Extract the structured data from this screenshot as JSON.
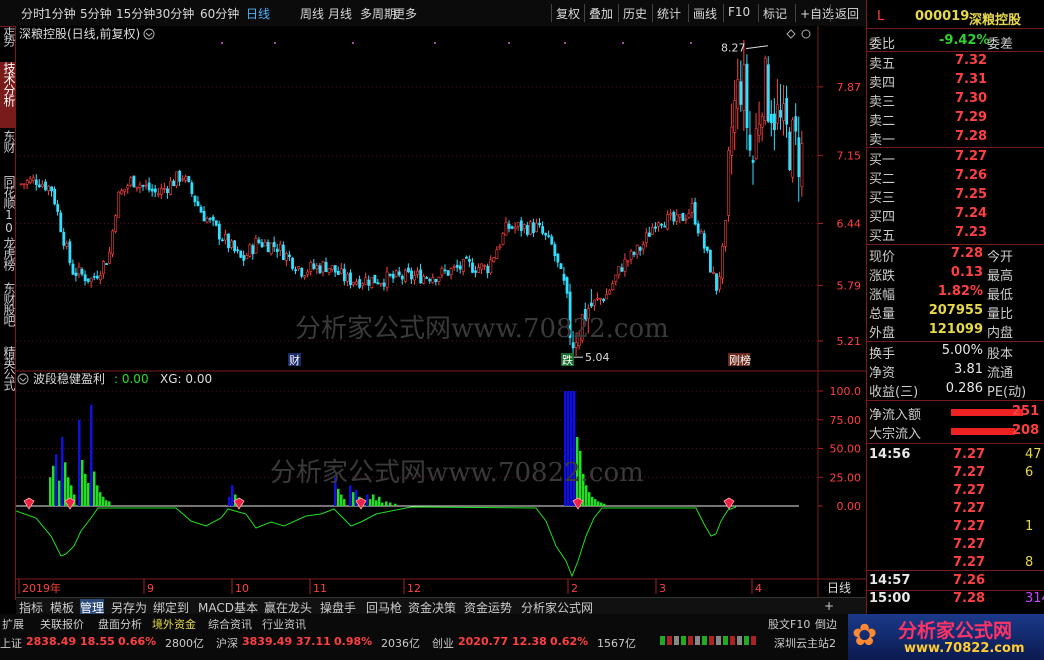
{
  "toolbar": {
    "period_tabs": [
      "分时",
      "1分钟",
      "5分钟",
      "15分钟",
      "30分钟",
      "60分钟",
      "日线",
      "周线",
      "月线",
      "多周期",
      "更多"
    ],
    "active_period": "日线",
    "right_tools": [
      "复权",
      "叠加",
      "历史",
      "统计",
      "画线",
      "F10",
      "标记",
      "+自选",
      "返回"
    ]
  },
  "left_tabs": [
    "分时走势",
    "技术分析",
    "东财10",
    "同花顺10",
    "龙虎榜",
    "东财股吧",
    "精英公式"
  ],
  "active_left_tab": "技术分析",
  "main_chart": {
    "title": "深粮控股(日线,前复权)",
    "high_label": "8.27",
    "low_label": "5.04",
    "y_ticks": [
      "7.87",
      "7.15",
      "6.44",
      "5.79",
      "5.21"
    ],
    "markers": [
      "财",
      "跌",
      "刚榜"
    ]
  },
  "indicator": {
    "name": "波段稳健盈利",
    "value_label": ": 0.00",
    "xg_label": "XG: 0.00",
    "y_ticks": [
      "100.0",
      "75.00",
      "50.00",
      "25.00",
      "0.00"
    ]
  },
  "date_axis": [
    "2019年",
    "9",
    "10",
    "11",
    "12",
    "2",
    "3",
    "4"
  ],
  "period_label": "日线",
  "bottom_tabs": [
    "指标",
    "模板",
    "管理",
    "另存为",
    "绑定到",
    "MACD基本",
    "赢在龙头",
    "操盘手",
    "回马枪",
    "资金决策",
    "资金运势",
    "分析家公式网"
  ],
  "active_bottom_tab": "管理",
  "bottom_right": {
    "plus": "+"
  },
  "bottom_right2": [
    "股文F10",
    "倒边"
  ],
  "watermark": "分析家公式网www.70822.com",
  "status_bar": {
    "expand": "扩展",
    "tabs": [
      "关联报价",
      "盘面分析",
      "境外资金",
      "综合资讯",
      "行业资讯"
    ],
    "indices": [
      {
        "name": "上证",
        "value": "2838.49",
        "change": "18.55",
        "pct": "0.66%",
        "amount": "2800亿"
      },
      {
        "name": "沪深",
        "value": "3839.49",
        "change": "37.11",
        "pct": "0.98%",
        "amount": "2036亿"
      },
      {
        "name": "创业",
        "value": "2020.77",
        "change": "12.38",
        "pct": "0.62%",
        "amount": "1567亿"
      }
    ],
    "server": "深圳云主站2",
    "logo_text": "分析家公式网",
    "logo_url": "www.70822.com"
  },
  "quote": {
    "code_prefix": "L",
    "code": "000019",
    "name": "深粮控股",
    "weibi_label": "委比",
    "weibi_value": "-9.42%",
    "weicha_label": "委差",
    "sells": [
      {
        "label": "卖五",
        "price": "7.32"
      },
      {
        "label": "卖四",
        "price": "7.31"
      },
      {
        "label": "卖三",
        "price": "7.30"
      },
      {
        "label": "卖二",
        "price": "7.29"
      },
      {
        "label": "卖一",
        "price": "7.28"
      }
    ],
    "buys": [
      {
        "label": "买一",
        "price": "7.27"
      },
      {
        "label": "买二",
        "price": "7.26"
      },
      {
        "label": "买三",
        "price": "7.25"
      },
      {
        "label": "买四",
        "price": "7.24"
      },
      {
        "label": "买五",
        "price": "7.23"
      }
    ],
    "stats": [
      {
        "label": "现价",
        "value": "7.28",
        "label2": "今开"
      },
      {
        "label": "涨跌",
        "value": "0.13",
        "label2": "最高"
      },
      {
        "label": "涨幅",
        "value": "1.82%",
        "label2": "最低"
      },
      {
        "label": "总量",
        "value": "207955",
        "label2": "量比"
      },
      {
        "label": "外盘",
        "value": "121099",
        "label2": "内盘"
      }
    ],
    "stats2": [
      {
        "label": "换手",
        "value": "5.00%",
        "label2": "股本"
      },
      {
        "label": "净资",
        "value": "3.81",
        "label2": "流通"
      },
      {
        "label": "收益(三)",
        "value": "0.286",
        "label2": "PE(动)"
      }
    ],
    "flows": [
      {
        "label": "净流入额",
        "value": "251"
      },
      {
        "label": "大宗流入",
        "value": "208"
      }
    ],
    "ticks": [
      {
        "time": "14:56",
        "price": "7.27",
        "vol": "47"
      },
      {
        "time": "",
        "price": "7.27",
        "vol": "6"
      },
      {
        "time": "",
        "price": "7.27",
        "vol": ""
      },
      {
        "time": "",
        "price": "7.27",
        "vol": ""
      },
      {
        "time": "",
        "price": "7.27",
        "vol": "1"
      },
      {
        "time": "",
        "price": "7.27",
        "vol": ""
      },
      {
        "time": "",
        "price": "7.27",
        "vol": "8"
      },
      {
        "time": "14:57",
        "price": "7.26",
        "vol": ""
      },
      {
        "time": "15:00",
        "price": "7.28",
        "vol": "314"
      }
    ]
  },
  "colors": {
    "up": "#ff4040",
    "down": "#31e0ff",
    "vol_blue": "#1010e0",
    "vol_green": "#20e020",
    "frame": "#7a1b1b"
  }
}
